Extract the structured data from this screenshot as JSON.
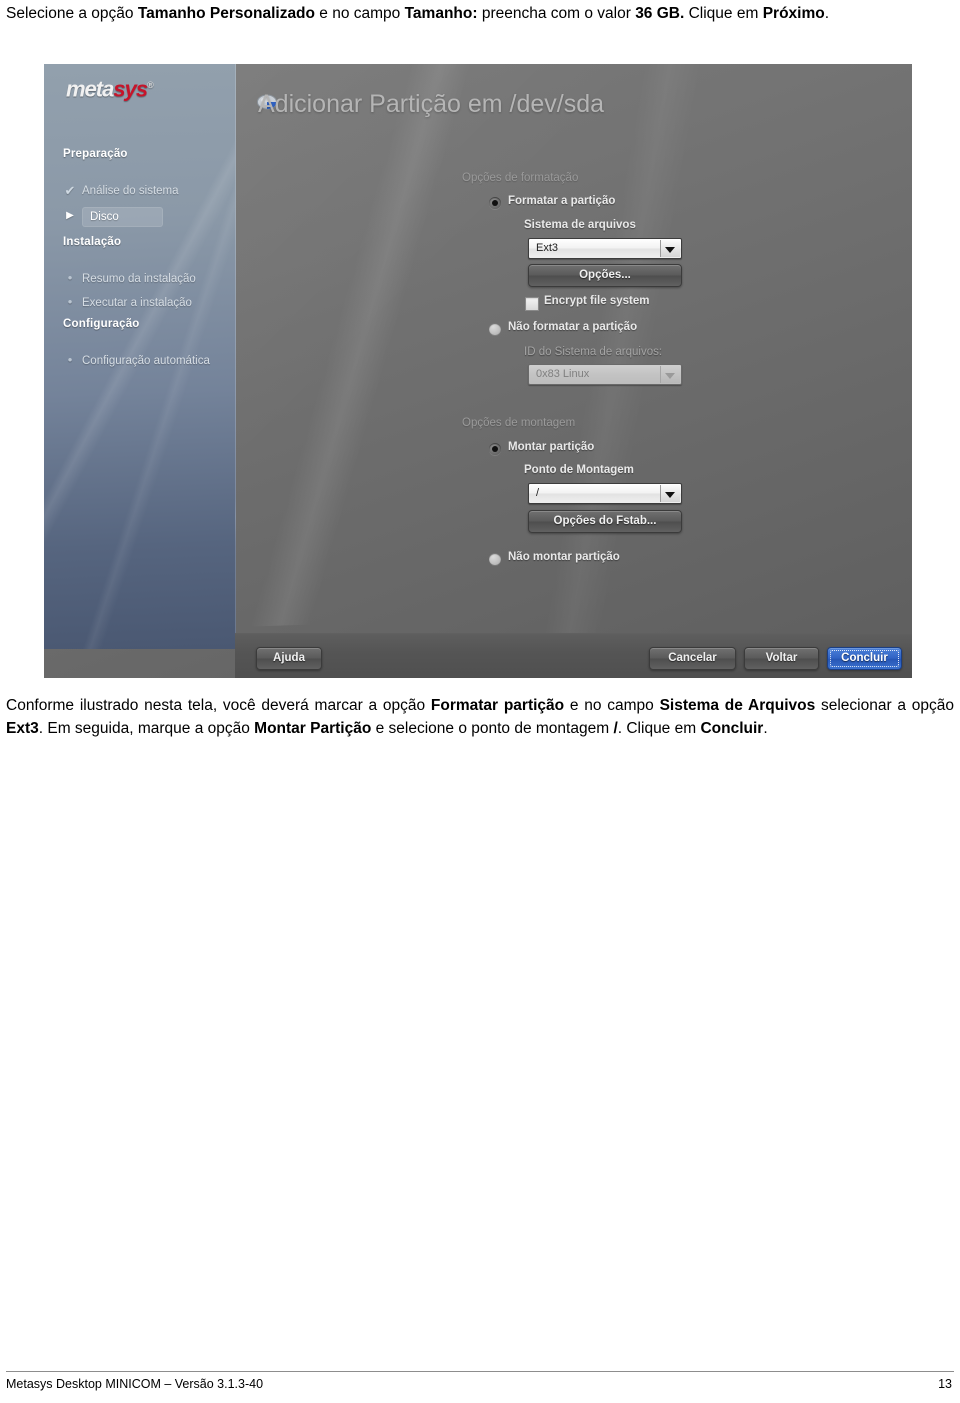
{
  "intro": {
    "prefix": "Selecione a opção ",
    "b1": "Tamanho Personalizado",
    "mid1": " e no campo ",
    "b2": "Tamanho:",
    "mid2": " preencha com o valor ",
    "b3": "36 GB.",
    "mid3": " Clique em ",
    "b4": "Próximo",
    "suffix": "."
  },
  "screenshot": {
    "sidebar": {
      "logo": {
        "first": "meta",
        "second": "sys",
        "tm": "®"
      },
      "groups": [
        {
          "label": "Preparação"
        },
        {
          "label": "Instalação"
        },
        {
          "label": "Configuração"
        }
      ],
      "items": [
        {
          "label": "Análise do sistema",
          "mark": "✔",
          "state": "done"
        },
        {
          "label": "Disco",
          "mark": "▶",
          "state": "current"
        },
        {
          "label": "Resumo da instalação",
          "mark": "•",
          "state": "todo"
        },
        {
          "label": "Executar a instalação",
          "mark": "•",
          "state": "todo"
        },
        {
          "label": "Configuração automática",
          "mark": "•",
          "state": "todo"
        }
      ]
    },
    "dialog": {
      "title": "Adicionar Partição em /dev/sda",
      "format_group": "Opções de formatação",
      "format_partition_radio": "Formatar a partição",
      "filesystem_label": "Sistema de arquivos",
      "filesystem_value": "Ext3",
      "options_button": "Opções...",
      "encrypt_checkbox": "Encrypt file system",
      "no_format_radio": "Não formatar a partição",
      "fs_id_label": "ID do Sistema de arquivos:",
      "fs_id_value": "0x83 Linux",
      "mount_group": "Opções de montagem",
      "mount_partition_radio": "Montar partição",
      "mount_point_label": "Ponto de Montagem",
      "mount_point_value": "/",
      "fstab_button": "Opções do Fstab...",
      "no_mount_radio": "Não montar partição",
      "help_button": "Ajuda",
      "cancel_button": "Cancelar",
      "back_button": "Voltar",
      "finish_button": "Concluir"
    },
    "colors": {
      "sidebar_top": "#92a0ad",
      "sidebar_bottom": "#4a5872",
      "logo_red": "#c7142a",
      "primary_button": "#2f62c4",
      "dialog_bg": "#6f6f6f"
    }
  },
  "follow": {
    "p1": "Conforme ilustrado nesta tela, você deverá marcar a opção ",
    "b1": "Formatar partição",
    "p2": " e no campo ",
    "b2": "Sistema de Arquivos",
    "p3": " selecionar a opção  ",
    "b3": "Ext3",
    "p4": ".  Em seguida, marque a opção ",
    "b4": "Montar Partição",
    "p5": " e selecione o ponto de montagem ",
    "b5": "/",
    "p6": ". Clique em ",
    "b6": "Concluir",
    "p7": "."
  },
  "footer": {
    "left": "Metasys Desktop MINICOM – Versão 3.1.3-40",
    "page": "13"
  }
}
